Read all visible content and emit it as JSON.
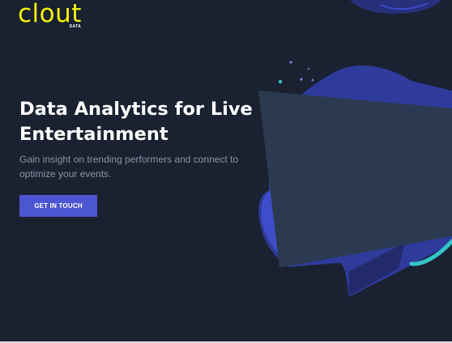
{
  "brand": {
    "name": "clout",
    "sub": "DATA",
    "color": "#f2f20c"
  },
  "hero": {
    "title_lines": [
      "Data Analytics for Live",
      "Entertainment"
    ],
    "subtitle_lines": [
      "Gain insight on trending performers and connect to",
      "optimize your events."
    ],
    "cta_label": "GET IN TOUCH"
  },
  "colors": {
    "background": "#1a2130",
    "accent_button": "#4c55d2",
    "screen_panel": "#2b3a50",
    "blob_primary": "#303ea0",
    "cyan_stroke": "#33c3c8"
  }
}
